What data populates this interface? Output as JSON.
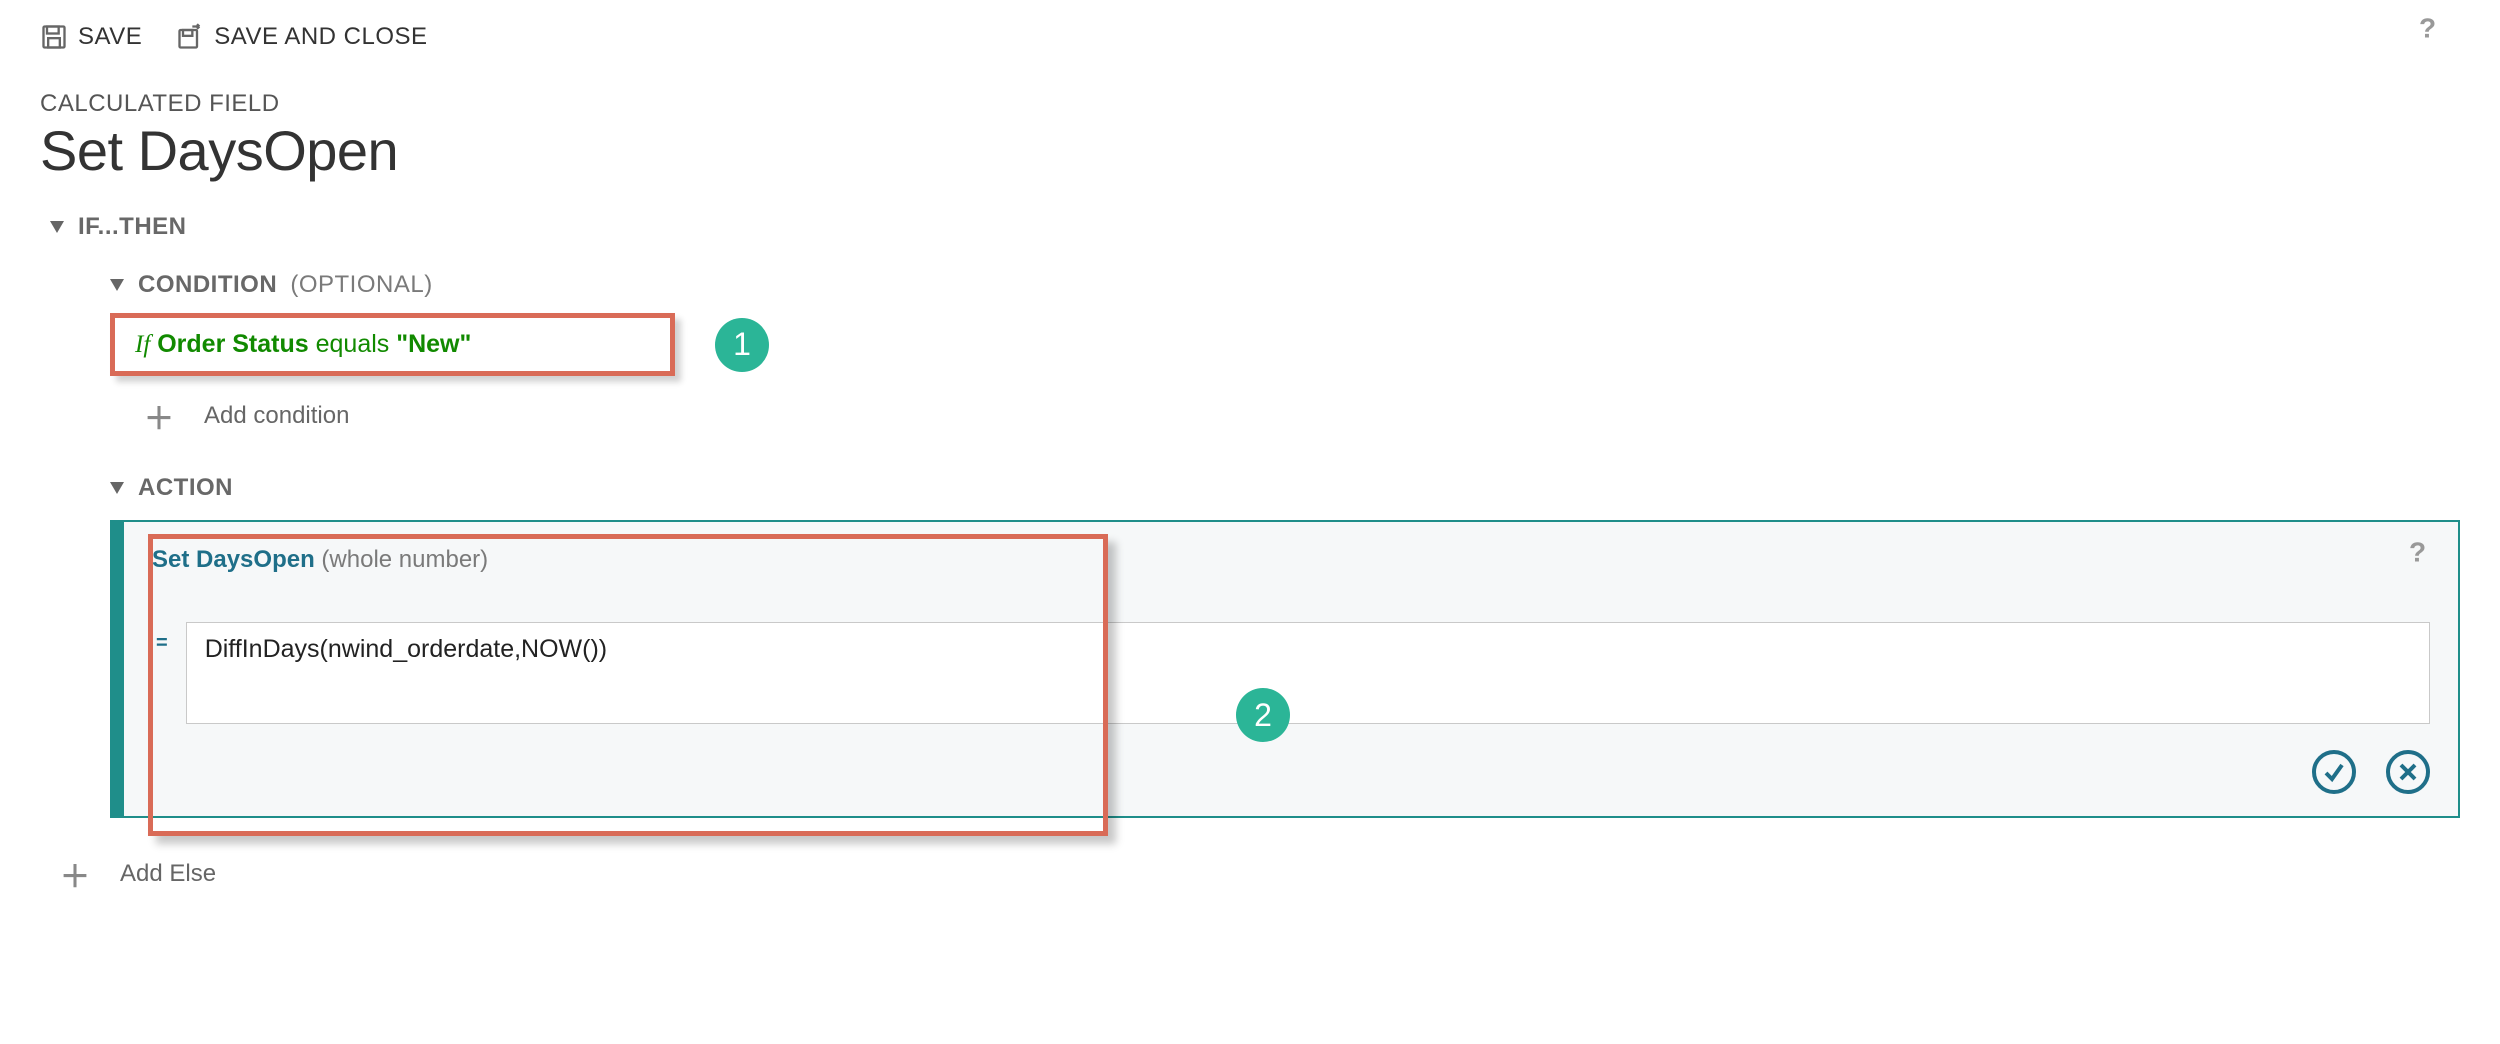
{
  "toolbar": {
    "save_label": "SAVE",
    "save_close_label": "SAVE AND CLOSE"
  },
  "header": {
    "subtitle": "CALCULATED FIELD",
    "title": "Set DaysOpen"
  },
  "if_then": {
    "section_label": "IF...THEN"
  },
  "condition": {
    "section_label": "CONDITION",
    "section_suffix": "(OPTIONAL)",
    "if_prefix": "If",
    "field": "Order Status",
    "operator": "equals",
    "value": "\"New\"",
    "add_condition": "Add condition"
  },
  "action": {
    "section_label": "ACTION",
    "title_prefix": "Set",
    "field_name": "DaysOpen",
    "field_type": "(whole number)",
    "formula": "DiffInDays(nwind_orderdate,NOW())"
  },
  "add_else_label": "Add Else",
  "annotations": {
    "badge1": "1",
    "badge2": "2"
  }
}
